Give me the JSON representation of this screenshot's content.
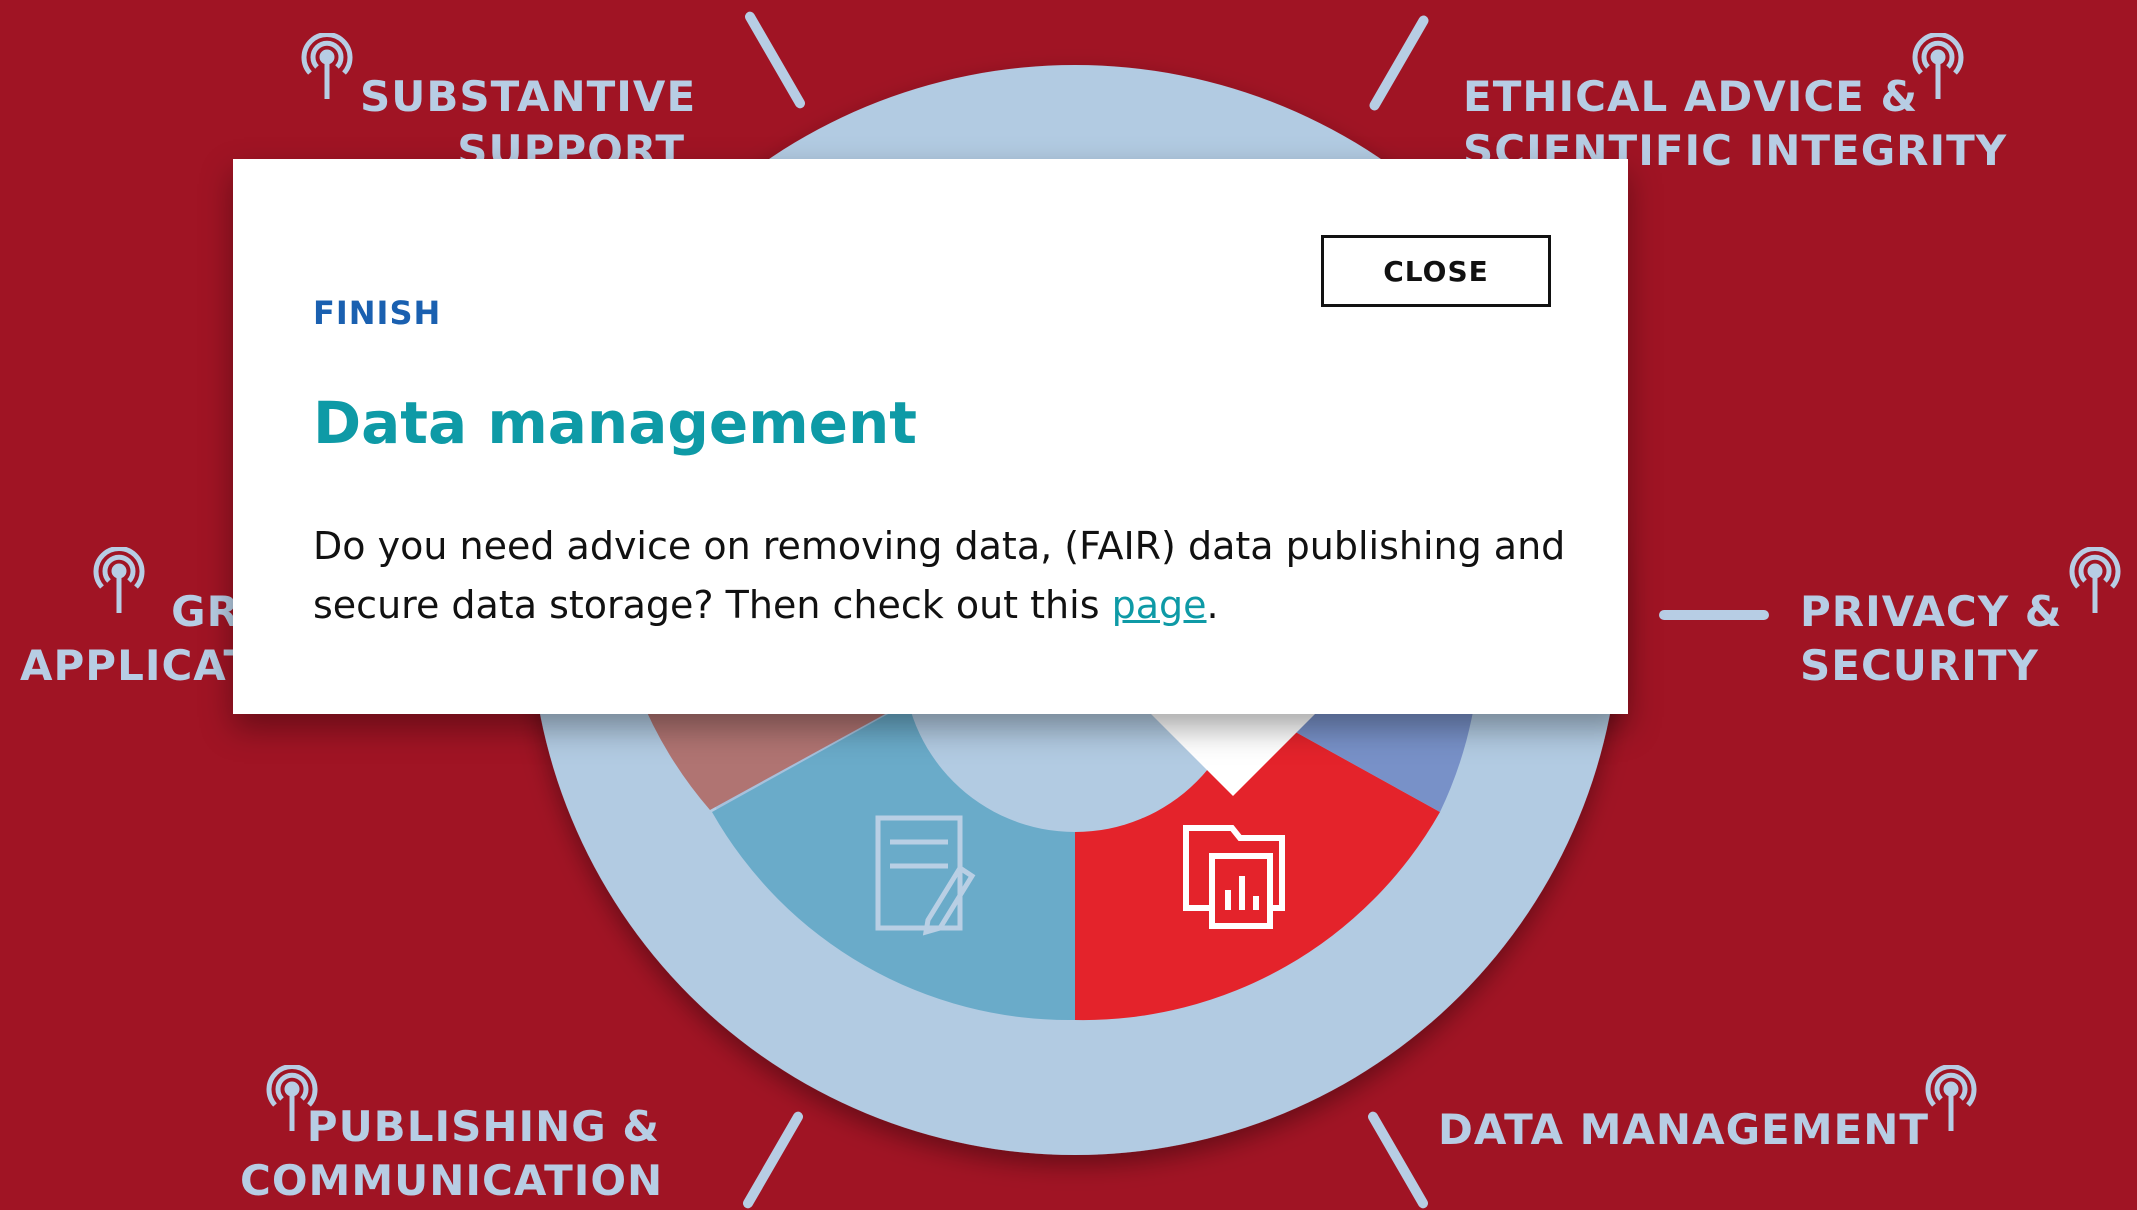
{
  "colors": {
    "background": "#a01424",
    "label_color": "#b7cde4",
    "ring_color": "#b2cbe2",
    "segment_teal": "#6aabc9",
    "segment_red": "#e4232b",
    "segment_blue": "#7891c8",
    "segment_rose": "#b07472",
    "kicker_color": "#1a60b0",
    "title_color": "#0e9aa6"
  },
  "categories": [
    {
      "id": "substantive-support",
      "lines": [
        "SUBSTANTIVE",
        "SUPPORT"
      ]
    },
    {
      "id": "ethical-advice",
      "lines": [
        "ETHICAL ADVICE &",
        "SCIENTIFIC INTEGRITY"
      ]
    },
    {
      "id": "grant-applications",
      "lines": [
        "GR",
        "APPLICAT"
      ]
    },
    {
      "id": "privacy-security",
      "lines": [
        "PRIVACY &",
        "SECURITY"
      ]
    },
    {
      "id": "publishing-communication",
      "lines": [
        "PUBLISHING &",
        "COMMUNICATION"
      ]
    },
    {
      "id": "data-management",
      "lines": [
        "DATA MANAGEMENT"
      ]
    }
  ],
  "icons": {
    "beacon": "signal-beacon-icon",
    "segment_teal": "document-edit-icon",
    "segment_red": "folder-chart-icon"
  },
  "modal": {
    "kicker": "FINISH",
    "title": "Data management",
    "close_label": "CLOSE",
    "body_before_link": "Do you need advice on removing data, (FAIR) data publishing and secure data storage? Then check out this ",
    "link_text": "page",
    "body_after_link": "."
  }
}
